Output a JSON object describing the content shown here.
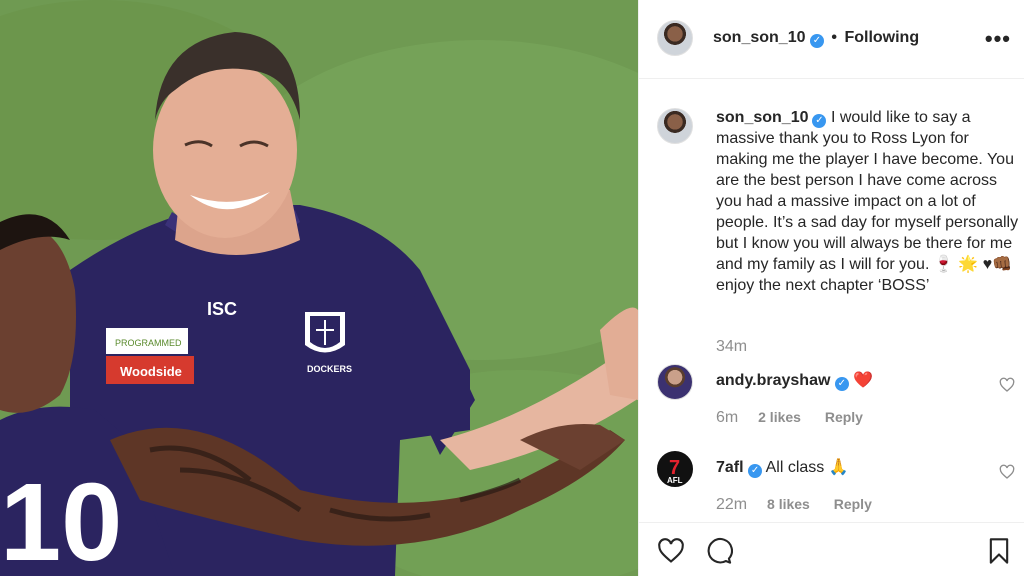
{
  "post": {
    "author": "son_son_10",
    "follow_status": "Following",
    "more_label": "•••"
  },
  "caption": {
    "author": "son_son_10",
    "text": "I would like to say a massive thank you to Ross Lyon for making me the player I have become. You are the best person I have come across you had a massive impact on a lot of people. It’s a sad day for myself personally but I know you will always be there for me and my family as I will for you. 🍷 🌟 ♥👊🏾  enjoy the next chapter ‘BOSS’",
    "time": "34m"
  },
  "comments": [
    {
      "author": "andy.brayshaw",
      "text": "❤️",
      "time": "6m",
      "likes": "2 likes",
      "reply": "Reply"
    },
    {
      "author": "7afl",
      "text": "All class 🙏",
      "time": "22m",
      "likes": "8 likes",
      "reply": "Reply"
    }
  ],
  "afl_logo": {
    "number": "7",
    "label": "AFL"
  },
  "photo_text": {
    "isc": "ISC",
    "programmed": "PROGRAMMED",
    "woodside": "Woodside",
    "dockers": "DOCKERS",
    "jersey_number": "10"
  },
  "colors": {
    "verified": "#3897f0",
    "muted": "#8e8e8e",
    "jersey": "#2b2460",
    "grass": "#6f9a52"
  },
  "icons": [
    "verified-badge-icon",
    "more-options-icon",
    "heart-icon",
    "comment-icon",
    "bookmark-icon",
    "like-comment-heart-icon"
  ]
}
